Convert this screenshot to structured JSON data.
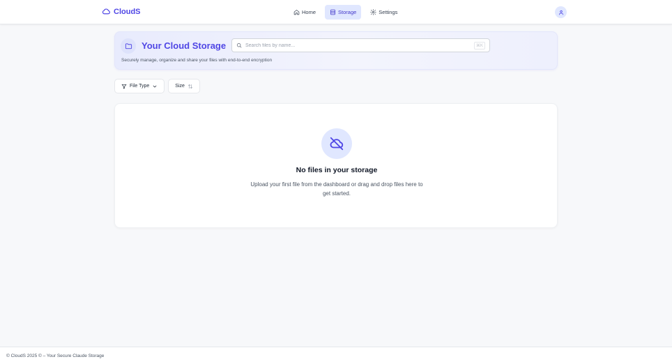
{
  "header": {
    "brand": "CloudS",
    "nav": [
      {
        "label": "Home",
        "icon": "home-icon"
      },
      {
        "label": "Storage",
        "icon": "database-icon",
        "active": true
      },
      {
        "label": "Settings",
        "icon": "gear-icon"
      }
    ],
    "avatar_icon": "user-icon"
  },
  "hero": {
    "title": "Your Cloud Storage",
    "subtitle": "Securely manage, organize and share your files with end-to-end encryption",
    "search": {
      "placeholder": "Search files by name...",
      "value": "",
      "shortcut": "⌘K"
    }
  },
  "filters": {
    "file_type_label": "File Type",
    "size_label": "Size"
  },
  "empty_state": {
    "title": "No files in your storage",
    "text": "Upload your first file from the dashboard or drag and drop files here to get started.",
    "icon": "cloud-off-icon"
  },
  "footer": {
    "text": "© CloudS 2025 © – Your Secure Claude Storage"
  },
  "colors": {
    "accent": "#4f46e5",
    "accent_light": "#e0e7ff",
    "background": "#f7f8fa"
  }
}
